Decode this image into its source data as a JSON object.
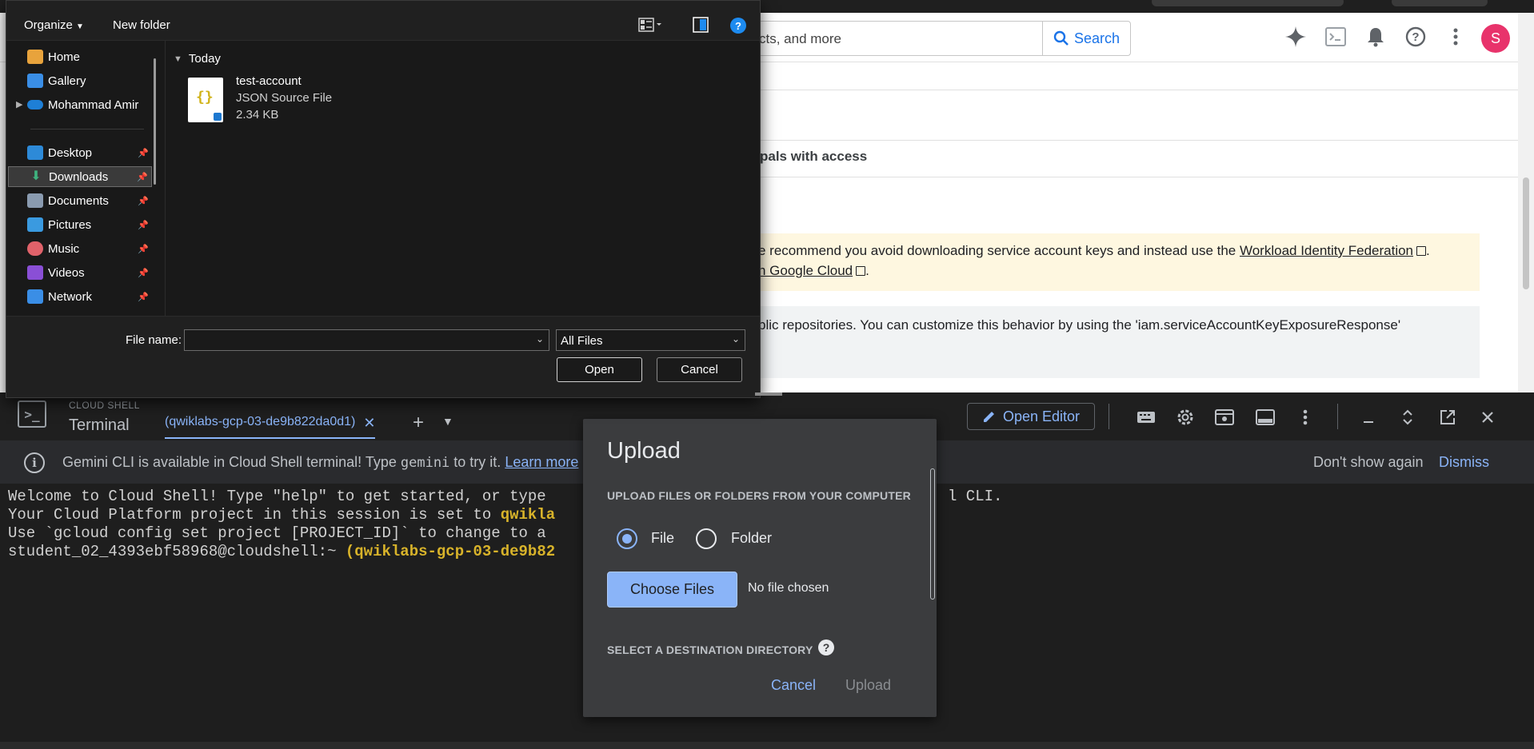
{
  "browser": {
    "search_placeholder": "cts, and more",
    "search_button": "Search",
    "avatar_letter": "S",
    "tab_partial": "pals with access",
    "warning_line1": "e recommend you avoid downloading service account keys and instead use the ",
    "warning_link1": "Workload Identity Federation",
    "warning_line1_end": ".",
    "warning_link2": "n Google Cloud",
    "warning_line2_end": ".",
    "info_line1": "blic repositories. You can customize this behavior by using the 'iam.serviceAccountKeyExposureResponse'"
  },
  "cloud_shell": {
    "label_small": "CLOUD SHELL",
    "title": "Terminal",
    "tab_label": "(qwiklabs-gcp-03-de9b822da0d1)",
    "tab_close": "✕",
    "open_editor": "Open Editor",
    "gemini_text_a": "Gemini CLI is available in Cloud Shell terminal! Type ",
    "gemini_cmd": "gemini",
    "gemini_text_b": " to try it. ",
    "gemini_link": "Learn more",
    "dont_show": "Don't show again",
    "dismiss": "Dismiss",
    "terminal_lines": [
      "Welcome to Cloud Shell! Type \"help\" to get started, or type",
      "Your Cloud Platform project in this session is set to ",
      "Use `gcloud config set project [PROJECT_ID]` to change to a",
      "student_02_4393ebf58968@cloudshell:~ "
    ],
    "terminal_line1_tail": "l CLI.",
    "terminal_line2_yellow": "qwikla",
    "terminal_line4_yellow": "(qwiklabs-gcp-03-de9b82"
  },
  "upload_dialog": {
    "title": "Upload",
    "section1": "UPLOAD FILES OR FOLDERS FROM YOUR COMPUTER",
    "option_file": "File",
    "option_folder": "Folder",
    "selected": "File",
    "choose_files": "Choose Files",
    "no_file": "No file chosen",
    "section2": "SELECT A DESTINATION DIRECTORY",
    "help_mark": "?",
    "cancel": "Cancel",
    "upload": "Upload"
  },
  "file_dialog": {
    "organize": "Organize",
    "new_folder": "New folder",
    "help": "?",
    "nav_items": [
      {
        "label": "Home",
        "icon": "home-icon",
        "pinned": false
      },
      {
        "label": "Gallery",
        "icon": "gallery-icon",
        "pinned": false
      },
      {
        "label": "Mohammad Amir",
        "icon": "onedrive-icon",
        "pinned": false
      },
      {
        "label": "Desktop",
        "icon": "desktop-icon",
        "pinned": true
      },
      {
        "label": "Downloads",
        "icon": "downloads-icon",
        "pinned": true
      },
      {
        "label": "Documents",
        "icon": "documents-icon",
        "pinned": true
      },
      {
        "label": "Pictures",
        "icon": "pictures-icon",
        "pinned": true
      },
      {
        "label": "Music",
        "icon": "music-icon",
        "pinned": true
      },
      {
        "label": "Videos",
        "icon": "videos-icon",
        "pinned": true
      },
      {
        "label": "Network",
        "icon": "network-icon",
        "pinned": true
      }
    ],
    "selected_nav": "Downloads",
    "group": "Today",
    "file": {
      "name": "test-account",
      "type": "JSON Source File",
      "size": "2.34 KB"
    },
    "file_name_label": "File name:",
    "file_name_value": "",
    "filter": "All Files",
    "open": "Open",
    "cancel": "Cancel"
  },
  "colors": {
    "accent_blue": "#8ab4f8",
    "google_blue": "#1a73e8",
    "avatar_pink": "#e8336b",
    "terminal_yellow": "#d8b32a"
  }
}
